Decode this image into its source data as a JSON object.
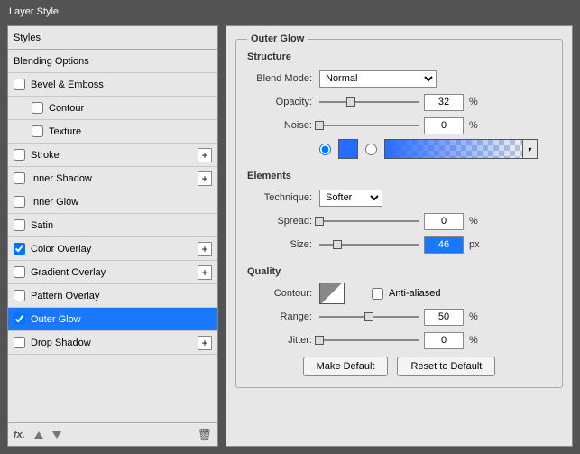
{
  "window": {
    "title": "Layer Style"
  },
  "sidebar": {
    "styles": "Styles",
    "blending": "Blending Options",
    "bevel": "Bevel & Emboss",
    "contour": "Contour",
    "texture": "Texture",
    "stroke": "Stroke",
    "innerShadow": "Inner Shadow",
    "innerGlow": "Inner Glow",
    "satin": "Satin",
    "colorOverlay": "Color Overlay",
    "gradientOverlay": "Gradient Overlay",
    "patternOverlay": "Pattern Overlay",
    "outerGlow": "Outer Glow",
    "dropShadow": "Drop Shadow"
  },
  "panel": {
    "title": "Outer Glow",
    "structure": {
      "head": "Structure",
      "blendModeLbl": "Blend Mode:",
      "blendMode": "Normal",
      "opacityLbl": "Opacity:",
      "opacity": "32",
      "noiseLbl": "Noise:",
      "noise": "0",
      "pct": "%"
    },
    "elements": {
      "head": "Elements",
      "techniqueLbl": "Technique:",
      "technique": "Softer",
      "spreadLbl": "Spread:",
      "spread": "0",
      "sizeLbl": "Size:",
      "size": "46",
      "pct": "%",
      "px": "px"
    },
    "quality": {
      "head": "Quality",
      "contourLbl": "Contour:",
      "antiLbl": "Anti-aliased",
      "rangeLbl": "Range:",
      "range": "50",
      "jitterLbl": "Jitter:",
      "jitter": "0",
      "pct": "%"
    },
    "buttons": {
      "makeDefault": "Make Default",
      "resetDefault": "Reset to Default"
    }
  }
}
